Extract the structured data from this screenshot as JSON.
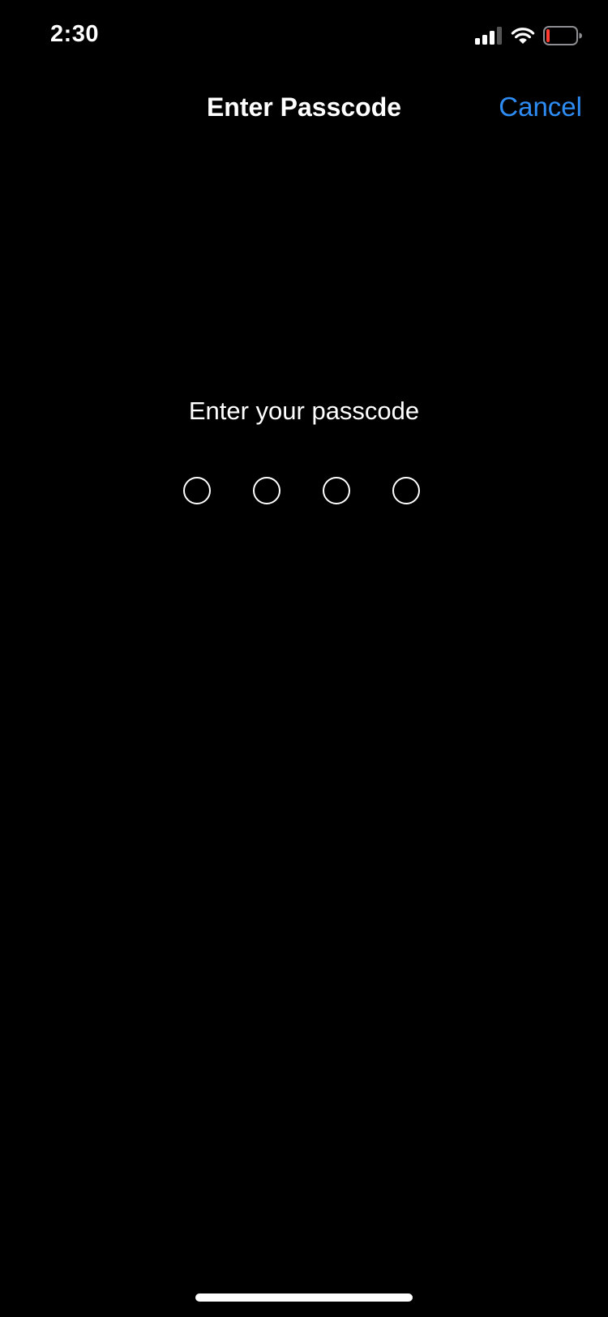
{
  "status_bar": {
    "time": "2:30",
    "signal_icon": "cellular-signal-icon",
    "wifi_icon": "wifi-icon",
    "battery_icon": "battery-low-icon",
    "battery_level": 0.1
  },
  "nav": {
    "title": "Enter Passcode",
    "cancel_label": "Cancel"
  },
  "passcode": {
    "prompt": "Enter your passcode",
    "digits_total": 4,
    "digits_entered": 0
  },
  "colors": {
    "background": "#000000",
    "text": "#ffffff",
    "accent": "#2e8df5",
    "battery_low": "#ff3b30"
  }
}
